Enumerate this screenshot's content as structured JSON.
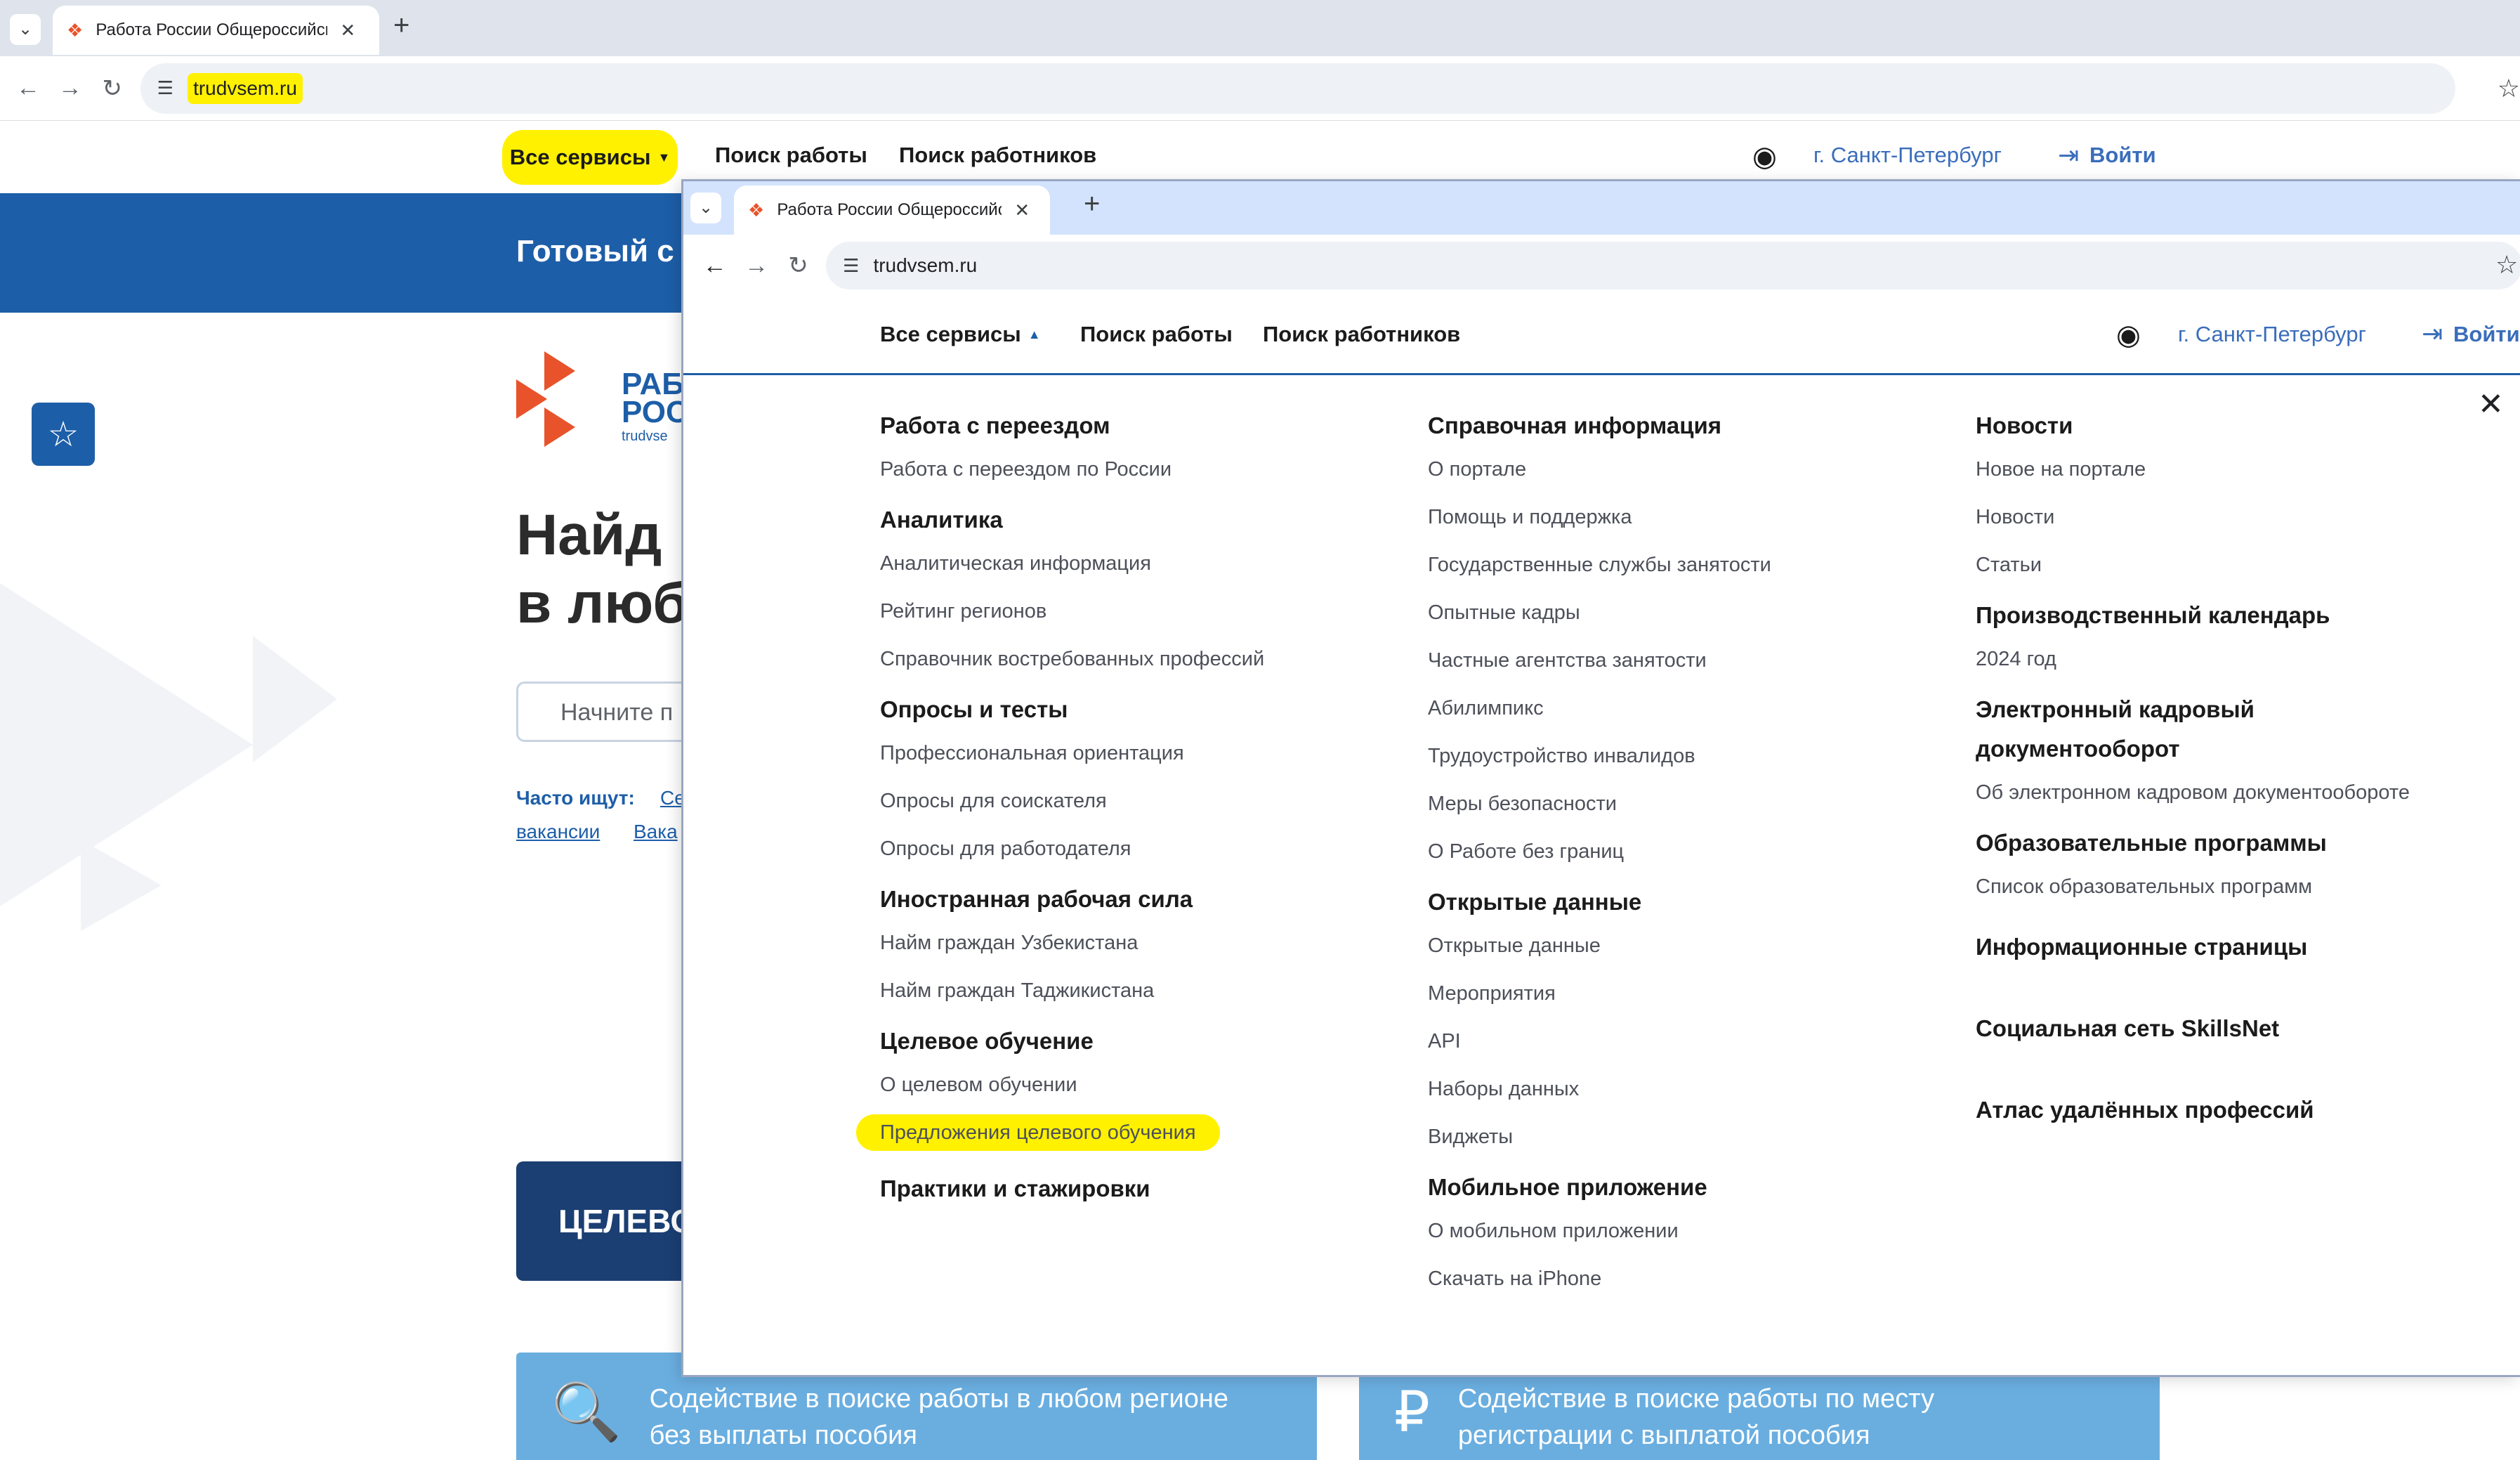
{
  "outer": {
    "tab_title": "Работа России Общероссийск",
    "url": "trudvsem.ru",
    "site_nav": {
      "all_services": "Все сервисы",
      "job_search": "Поиск работы",
      "worker_search": "Поиск работников",
      "city": "г. Санкт-Петербург",
      "login": "Войти"
    },
    "banner_text": "Готовый с",
    "logo_text_1": "РАБ",
    "logo_text_2": "РОС",
    "logo_sub": "trudvse",
    "headline_1": "Найд",
    "headline_2": "в люб",
    "search_placeholder": "Начните п",
    "often_label": "Часто ищут:",
    "often_link_1": "Се",
    "often_link_2": "вакансии",
    "often_link_3": "Вака",
    "target_banner": "ЦЕЛЕВО",
    "card_1": "Содействие в поиске работы в любом регионе без выплаты пособия",
    "card_2": "Содействие в поиске работы по месту регистрации с выплатой пособия"
  },
  "inner": {
    "tab_title": "Работа России Общероссийск",
    "url": "trudvsem.ru",
    "site_nav": {
      "all_services": "Все сервисы",
      "job_search": "Поиск работы",
      "worker_search": "Поиск работников",
      "city": "г. Санкт-Петербург",
      "login": "Войти"
    },
    "columns": [
      {
        "sections": [
          {
            "title": "Работа с переездом",
            "links": [
              "Работа с переездом по России"
            ]
          },
          {
            "title": "Аналитика",
            "links": [
              "Аналитическая информация",
              "Рейтинг регионов",
              "Справочник востребованных профессий"
            ]
          },
          {
            "title": "Опросы и тесты",
            "links": [
              "Профессиональная ориентация",
              "Опросы для соискателя",
              "Опросы для работодателя"
            ]
          },
          {
            "title": "Иностранная рабочая сила",
            "links": [
              "Найм граждан Узбекистана",
              "Найм граждан Таджикистана"
            ]
          },
          {
            "title": "Целевое обучение",
            "links": [
              "О целевом обучении",
              "Предложения целевого обучения"
            ]
          },
          {
            "title": "Практики и стажировки",
            "links": []
          }
        ]
      },
      {
        "sections": [
          {
            "title": "Справочная информация",
            "links": [
              "О портале",
              "Помощь и поддержка",
              "Государственные службы занятости",
              "Опытные кадры",
              "Частные агентства занятости",
              "Абилимпикс",
              "Трудоустройство инвалидов",
              "Меры безопасности",
              "О Работе без границ"
            ]
          },
          {
            "title": "Открытые данные",
            "links": [
              "Открытые данные",
              "Мероприятия",
              "API",
              "Наборы данных",
              "Виджеты"
            ]
          },
          {
            "title": "Мобильное приложение",
            "links": [
              "О мобильном приложении",
              "Скачать на iPhone"
            ]
          }
        ]
      },
      {
        "sections": [
          {
            "title": "Новости",
            "links": [
              "Новое на портале",
              "Новости",
              "Статьи"
            ]
          },
          {
            "title": "Производственный календарь",
            "links": [
              "2024 год"
            ]
          },
          {
            "title_lines": [
              "Электронный кадровый",
              "документооборот"
            ],
            "links": [
              "Об электронном кадровом документообороте"
            ]
          },
          {
            "title": "Образовательные программы",
            "links": [
              "Список образовательных программ"
            ]
          },
          {
            "title": "Информационные страницы",
            "links": []
          },
          {
            "title": "Социальная сеть SkillsNet",
            "links": []
          },
          {
            "title": "Атлас удалённых профессий",
            "links": []
          }
        ]
      }
    ]
  },
  "colors": {
    "brand_blue": "#1d5ea8",
    "dark_navy": "#1b3f73",
    "highlight": "#fff100",
    "card_blue": "#6aaee0",
    "link_blue": "#3a6dbb",
    "logo_red": "#e8532b"
  }
}
